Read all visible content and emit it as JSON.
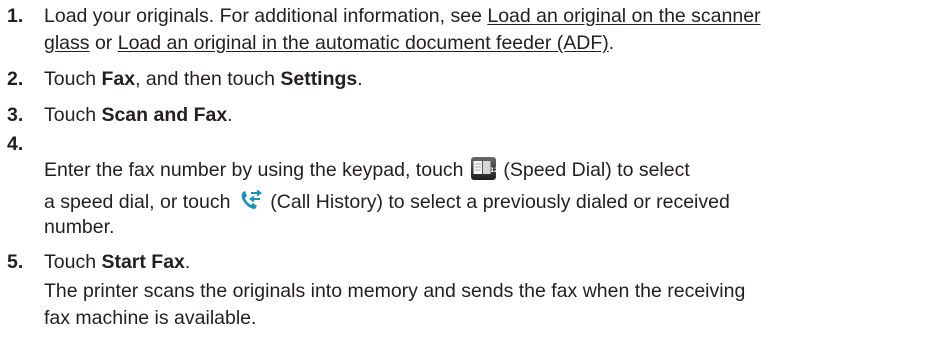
{
  "steps": [
    {
      "number": "1.",
      "line1_prefix": "Load your originals. For additional information, see ",
      "link1_line1": "Load an original on the scanner",
      "link1_line2": "glass",
      "middle": " or ",
      "link2": "Load an original in the automatic document feeder (ADF)",
      "suffix": "."
    },
    {
      "number": "2.",
      "t1": "Touch ",
      "b1": "Fax",
      "t2": ", and then touch ",
      "b2": "Settings",
      "t3": "."
    },
    {
      "number": "3.",
      "t1": "Touch ",
      "b1": "Scan and Fax",
      "t2": "."
    },
    {
      "number": "4.",
      "t1": "Enter the fax number by using the keypad, touch ",
      "icon1": "speed-dial-icon",
      "t2": " (Speed Dial) to select",
      "t3": "a speed dial, or touch ",
      "icon2": "call-history-icon",
      "t4": " (Call History) to select a previously dialed or received",
      "t5": "number."
    },
    {
      "number": "5.",
      "t1": "Touch ",
      "b1": "Start Fax",
      "t2": ".",
      "note_line1": "The printer scans the originals into memory and sends the fax when the receiving",
      "note_line2": "fax machine is available."
    }
  ]
}
